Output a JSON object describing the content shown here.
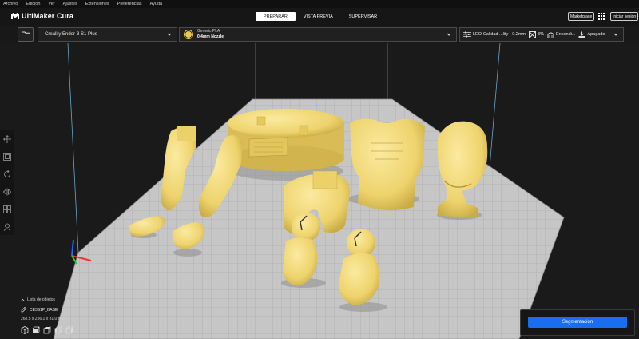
{
  "menu": [
    "Archivo",
    "Edición",
    "Ver",
    "Ajustes",
    "Extensiones",
    "Preferencias",
    "Ayuda"
  ],
  "app": {
    "title": "UltiMaker Cura"
  },
  "stages": [
    {
      "label": "PREPARAR",
      "active": true
    },
    {
      "label": "VISTA PREVIA",
      "active": false
    },
    {
      "label": "SUPERVISAR",
      "active": false
    }
  ],
  "header_buttons": {
    "marketplace": "Marketplace",
    "signin": "Iniciar sesión"
  },
  "printer": {
    "name": "Creality Ender-3 S1 Plus"
  },
  "material": {
    "name": "Generic PLA",
    "nozzle": "0.4mm Nozzle",
    "color": "#e8c94a"
  },
  "print_settings": {
    "profile": "LEO-Calidad ...lity - 0.2mm",
    "infill": "3%",
    "support": "Encendi...",
    "adhesion": "Apagado"
  },
  "object_list": {
    "title": "Lista de objetos",
    "object_name": "CE3S1P_BASE",
    "dimensions": "268.5 x 256.1 x 81.0 mm"
  },
  "slice": {
    "button_label": "Segmentación"
  },
  "colors": {
    "accent": "#196ef0",
    "model": "#f2dc7a",
    "plate": "#bcbcbc"
  },
  "icons": {
    "tools": [
      "move-icon",
      "scale-icon",
      "rotate-icon",
      "mirror-icon",
      "per-model-settings-icon",
      "support-blocker-icon"
    ],
    "views": [
      "view-3d-icon",
      "view-front-icon",
      "view-top-icon",
      "view-left-icon",
      "view-right-icon"
    ]
  }
}
